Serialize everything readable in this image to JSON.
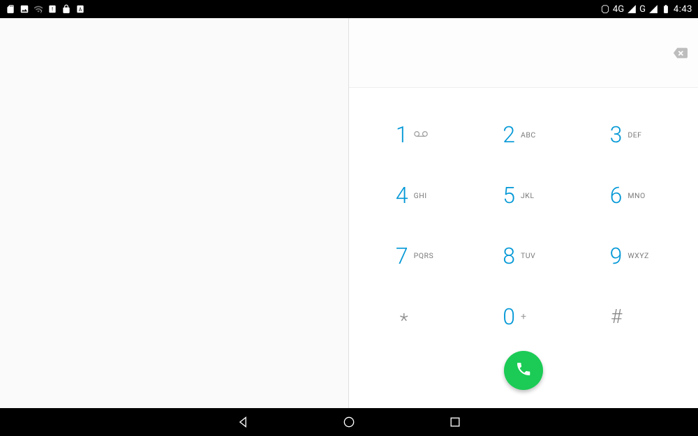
{
  "status": {
    "clock": "4:43",
    "net1": "4G",
    "net2": "G"
  },
  "dialer": {
    "number_entered": "",
    "keys": [
      {
        "digit": "1",
        "letters": ""
      },
      {
        "digit": "2",
        "letters": "ABC"
      },
      {
        "digit": "3",
        "letters": "DEF"
      },
      {
        "digit": "4",
        "letters": "GHI"
      },
      {
        "digit": "5",
        "letters": "JKL"
      },
      {
        "digit": "6",
        "letters": "MNO"
      },
      {
        "digit": "7",
        "letters": "PQRS"
      },
      {
        "digit": "8",
        "letters": "TUV"
      },
      {
        "digit": "9",
        "letters": "WXYZ"
      },
      {
        "digit": "*",
        "letters": ""
      },
      {
        "digit": "0",
        "letters": "+"
      },
      {
        "digit": "#",
        "letters": ""
      }
    ]
  },
  "colors": {
    "accent_digit": "#0097d6",
    "call_green": "#1bcb55"
  }
}
